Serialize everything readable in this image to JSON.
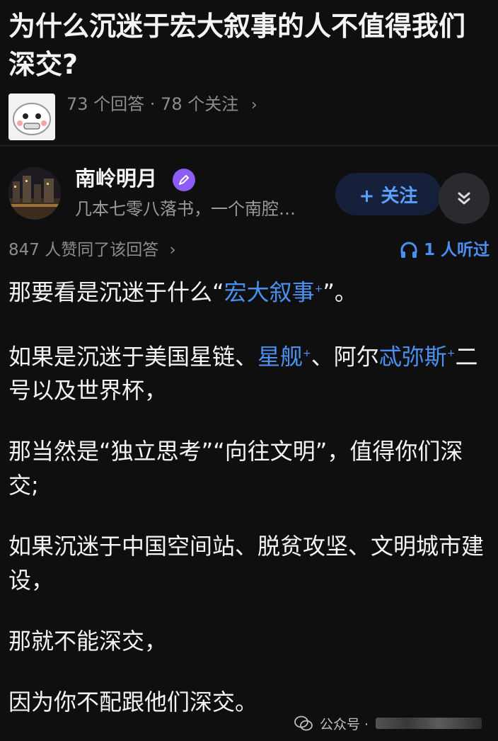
{
  "question": {
    "title": "为什么沉迷于宏大叙事的人不值得我们深交?",
    "stats": "73 个回答 · 78 个关注",
    "chevron": "›"
  },
  "author": {
    "name": "南岭明月",
    "bio": "几本七零八落书，一个南腔…",
    "follow_label": "+ 关注",
    "badge_icon": "pen-badge-icon",
    "expand_icon": "double-chevron-down-icon"
  },
  "answer_stats": {
    "likes": "847 人赞同了该回答",
    "chevron": "›",
    "listeners": "1 人听过"
  },
  "content": {
    "p1": {
      "a": "那要看是沉迷于什么“",
      "link": "宏大叙事",
      "b": "”。"
    },
    "p2": {
      "a": "如果是沉迷于美国星链、",
      "link1": "星舰",
      "b": "、阿尔",
      "link2": "忒弥斯",
      "c": "二号以及世界杯，"
    },
    "p3": "那当然是“独立思考”“向往文明”，值得你们深交;",
    "p4": "如果沉迷于中国空间站、脱贫攻坚、文明城市建设，",
    "p5": "那就不能深交，",
    "p6": "因为你不配跟他们深交。"
  },
  "watermark": {
    "label": "公众号 ·"
  },
  "colors": {
    "background": "#0f0f10",
    "link": "#4a90f0",
    "muted": "#8c8c8c",
    "follow_bg": "#16203a"
  }
}
